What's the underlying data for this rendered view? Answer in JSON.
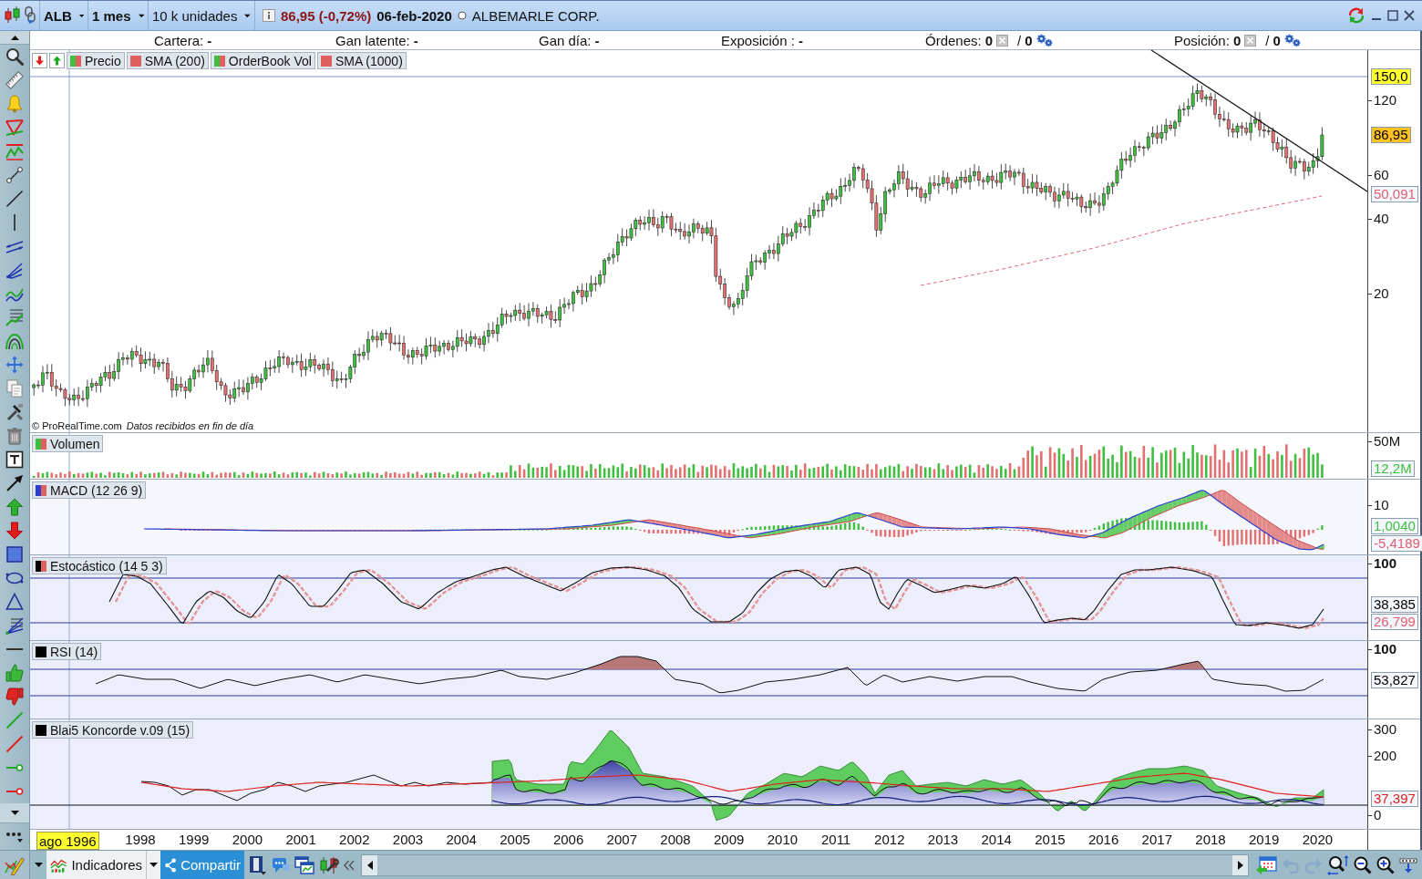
{
  "title_bar": {
    "symbol": "ALB",
    "period": "1 mes",
    "units": "10 k unidades",
    "quote": "86,95 (-0,72%)",
    "date": "06-feb-2020",
    "company": "ALBEMARLE CORP."
  },
  "summary": [
    {
      "kind": "plain",
      "label": "Cartera:",
      "value": "-"
    },
    {
      "kind": "plain",
      "label": "Gan latente:",
      "value": "-"
    },
    {
      "kind": "plain",
      "label": "Gan día:",
      "value": "-"
    },
    {
      "kind": "plain",
      "label": "Exposición :",
      "value": "-"
    },
    {
      "kind": "counter",
      "label": "Órdenes:",
      "value": "0",
      "separator": "/",
      "value2": "0"
    },
    {
      "kind": "counter",
      "label": "Posición:",
      "value": "0",
      "separator": "/",
      "value2": "0"
    }
  ],
  "panels": [
    {
      "kind": "price",
      "legend": [
        {
          "label": "Precio",
          "swatch": [
            {
              "color": "#3fbf3f"
            },
            {
              "color": "#e06060"
            }
          ]
        },
        {
          "label": "SMA (200)",
          "swatch": [
            {
              "color": "#e06060"
            }
          ]
        },
        {
          "label": "OrderBook Vol",
          "swatch": [
            {
              "color": "#3fbf3f"
            },
            {
              "color": "#e06060"
            }
          ]
        },
        {
          "label": "SMA (1000)",
          "swatch": [
            {
              "color": "#e06060"
            }
          ]
        }
      ],
      "credit": "© ProRealTime.com",
      "credit_note": "Datos recibidos en fin de día",
      "axis_labels": [
        "120",
        "60",
        "40",
        "20"
      ],
      "badges": [
        {
          "text": "150,0",
          "kind": "highlight"
        },
        {
          "text": "86,95",
          "kind": "price"
        },
        {
          "text": "50,091",
          "kind": "value",
          "color": "#e06070"
        }
      ]
    },
    {
      "kind": "volume",
      "legend": [
        {
          "label": "Volumen",
          "swatch": [
            {
              "color": "#3fbf3f"
            },
            {
              "color": "#e06060"
            }
          ]
        }
      ],
      "axis_labels": [
        "50M"
      ],
      "badges": [
        {
          "text": "12,2M",
          "kind": "value",
          "color": "#3fbf3f"
        }
      ]
    },
    {
      "kind": "macd",
      "legend": [
        {
          "label": "MACD (12 26 9)",
          "swatch": [
            {
              "color": "#2a3fd0"
            },
            {
              "color": "#e06060"
            }
          ]
        }
      ],
      "axis_labels": [
        "10"
      ],
      "badges": [
        {
          "text": "1,0040",
          "kind": "value",
          "color": "#3fbf3f"
        },
        {
          "text": "-5,4189",
          "kind": "value",
          "color": "#e06070"
        }
      ]
    },
    {
      "kind": "stochastic",
      "legend": [
        {
          "label": "Estocástico (14 5 3)",
          "swatch": [
            {
              "color": "#000000"
            },
            {
              "color": "#e06060"
            }
          ]
        }
      ],
      "axis_labels": [
        "100"
      ],
      "badges": [
        {
          "text": "38,385",
          "kind": "value",
          "color": "#000000"
        },
        {
          "text": "26,799",
          "kind": "value",
          "color": "#e06070"
        }
      ]
    },
    {
      "kind": "rsi",
      "legend": [
        {
          "label": "RSI (14)",
          "swatch": [
            {
              "color": "#000000"
            }
          ]
        }
      ],
      "axis_labels": [
        "100"
      ],
      "badges": [
        {
          "text": "53,827",
          "kind": "value",
          "color": "#000000"
        }
      ]
    },
    {
      "kind": "koncorde",
      "legend": [
        {
          "label": "Blai5 Koncorde v.09 (15)",
          "swatch": [
            {
              "color": "#000000"
            }
          ]
        }
      ],
      "axis_labels": [
        "300",
        "200",
        "0"
      ],
      "badges": [
        {
          "text": "37,397",
          "kind": "value",
          "color": "#e02020"
        }
      ]
    }
  ],
  "x_axis": {
    "cursor_date": "ago 1996",
    "years": [
      "1998",
      "1999",
      "2000",
      "2001",
      "2002",
      "2003",
      "2004",
      "2005",
      "2006",
      "2007",
      "2008",
      "2009",
      "2010",
      "2011",
      "2012",
      "2013",
      "2014",
      "2015",
      "2016",
      "2017",
      "2018",
      "2019",
      "2020"
    ]
  },
  "bottom_bar": {
    "indicators_button": "Indicadores",
    "share_button": "Compartir",
    "undo": {
      "disabled": true
    },
    "redo": {
      "disabled": true
    }
  }
}
